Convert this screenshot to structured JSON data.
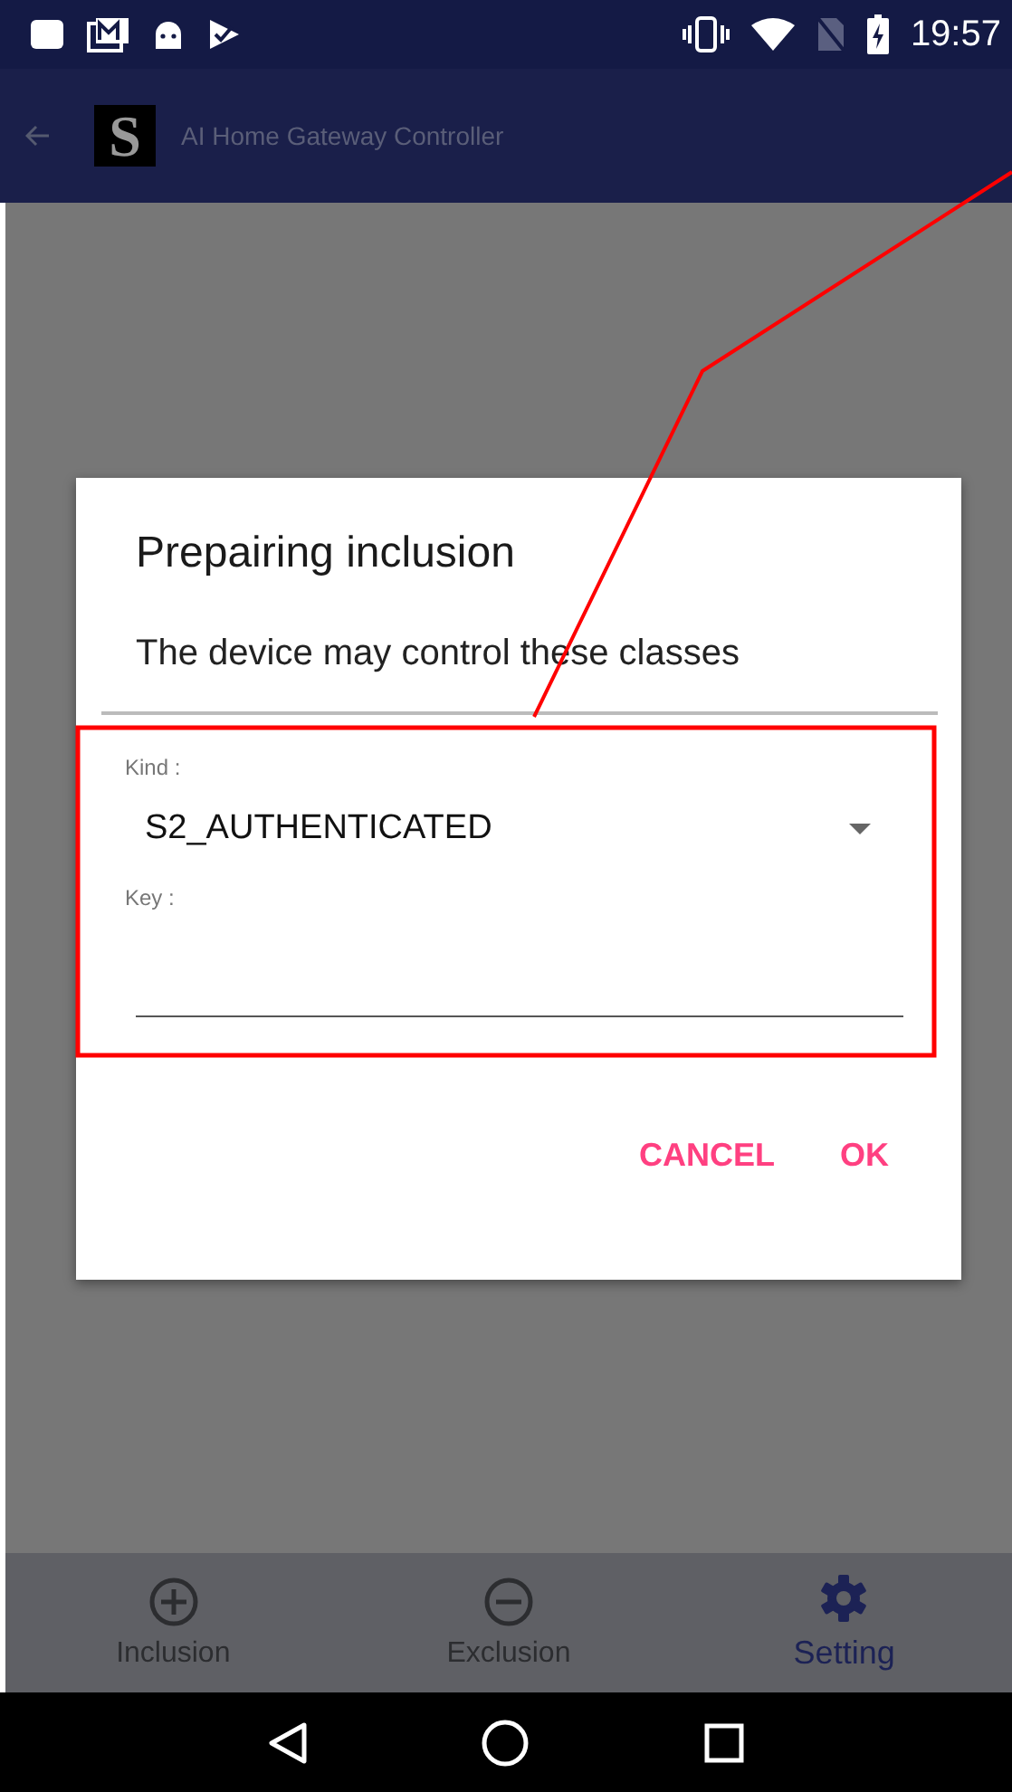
{
  "status_bar": {
    "time": "19:57"
  },
  "app_bar": {
    "logo": "S",
    "title": "AI Home Gateway Controller"
  },
  "dialog": {
    "title": "Prepairing inclusion",
    "message": "The device may control these classes",
    "kind_field": {
      "label": "Kind :",
      "value": "S2_AUTHENTICATED"
    },
    "key_field": {
      "label": "Key :"
    },
    "buttons": [
      "CANCEL",
      "OK"
    ]
  },
  "bottom_nav": [
    {
      "kind": "plus",
      "label": "Inclusion",
      "selected": false
    },
    {
      "kind": "minus",
      "label": "Exclusion",
      "selected": false
    },
    {
      "kind": "gear",
      "label": "Setting",
      "selected": true
    }
  ]
}
